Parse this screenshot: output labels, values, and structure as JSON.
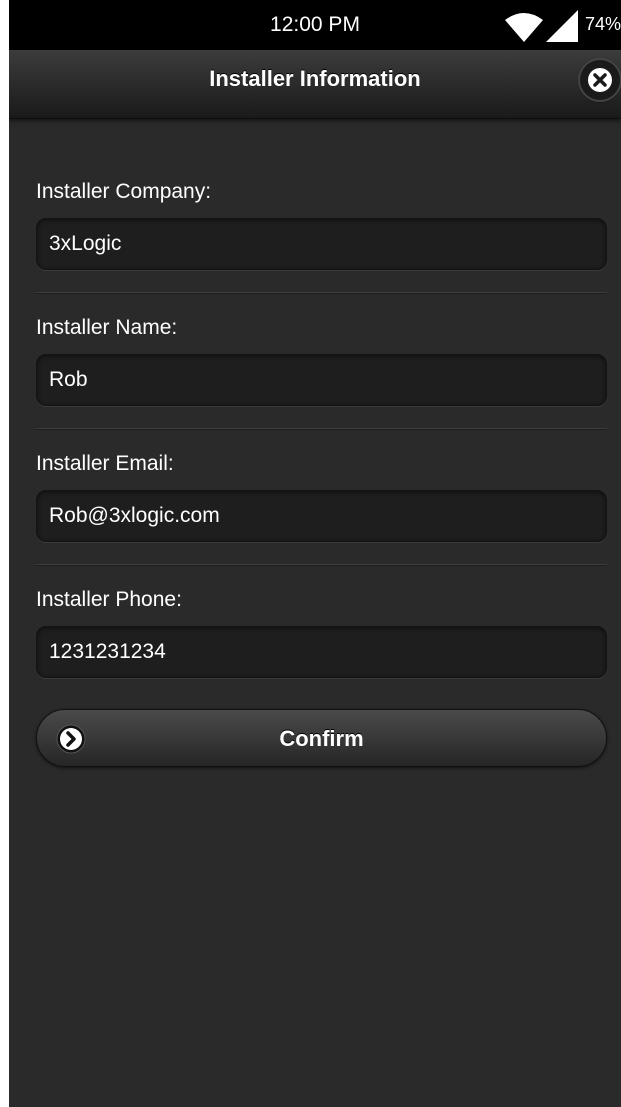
{
  "status_bar": {
    "time": "12:00 PM",
    "battery": "74%",
    "wifi_icon": "wifi-icon",
    "signal_icon": "cell-signal-icon"
  },
  "header": {
    "title": "Installer Information",
    "close_icon": "close-icon"
  },
  "form": {
    "fields": [
      {
        "label": "Installer Company:",
        "value": "3xLogic"
      },
      {
        "label": "Installer Name:",
        "value": "Rob"
      },
      {
        "label": "Installer Email:",
        "value": "Rob@3xlogic.com"
      },
      {
        "label": "Installer Phone:",
        "value": "1231231234"
      }
    ]
  },
  "confirm": {
    "label": "Confirm",
    "icon": "chevron-right-icon"
  },
  "colors": {
    "background": "#2a2a2a",
    "header": "#262626",
    "input": "#1e1e1e",
    "text": "#ffffff"
  }
}
